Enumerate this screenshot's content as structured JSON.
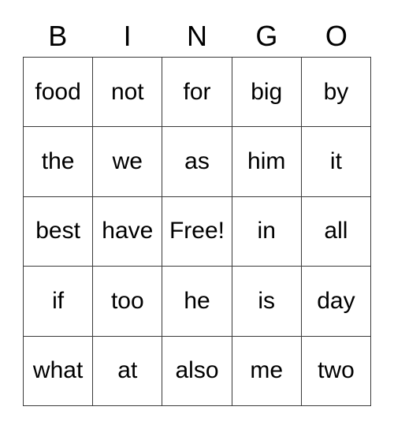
{
  "card": {
    "title": "BINGO",
    "header_letters": [
      "B",
      "I",
      "N",
      "G",
      "O"
    ],
    "free_space_label": "Free!",
    "free_space_position": {
      "row": 2,
      "col": 2
    },
    "grid_size": "5x5",
    "colors": {
      "background": "#ffffff",
      "text": "#000000",
      "border": "#3a3a3a"
    },
    "rows": [
      {
        "cells": [
          "food",
          "not",
          "for",
          "big",
          "by"
        ]
      },
      {
        "cells": [
          "the",
          "we",
          "as",
          "him",
          "it"
        ]
      },
      {
        "cells": [
          "best",
          "have",
          "Free!",
          "in",
          "all"
        ]
      },
      {
        "cells": [
          "if",
          "too",
          "he",
          "is",
          "day"
        ]
      },
      {
        "cells": [
          "what",
          "at",
          "also",
          "me",
          "two"
        ]
      }
    ]
  }
}
